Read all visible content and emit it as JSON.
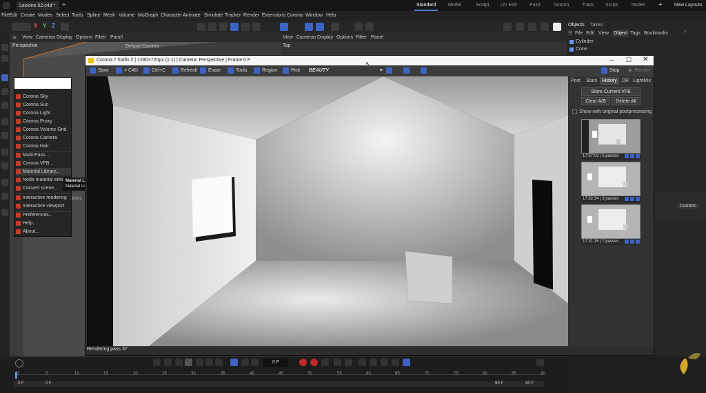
{
  "app": {
    "doc_tab": "Lezione 02.c4d *",
    "layouts": [
      "Standard",
      "Model",
      "Sculpt",
      "UV Edit",
      "Paint",
      "Groom",
      "Track",
      "Script",
      "Nodes"
    ],
    "new_layouts": "New Layouts"
  },
  "menu": [
    "File",
    "Edit",
    "Create",
    "Modes",
    "Select",
    "Tools",
    "Spline",
    "Mesh",
    "Volume",
    "MoGraph",
    "Character",
    "Animate",
    "Simulate",
    "Tracker",
    "Render",
    "Extensions",
    "Corona",
    "Window",
    "Help"
  ],
  "toolbar": {
    "axis_x": "X",
    "axis_y": "Y",
    "axis_z": "Z"
  },
  "viewport_left": {
    "menus": [
      "View",
      "Cameras",
      "Display",
      "Options",
      "Filter",
      "Panel"
    ],
    "name": "Perspective",
    "camera_label": "Default Camera"
  },
  "viewport_right": {
    "menus": [
      "View",
      "Cameras",
      "Display",
      "Options",
      "Filter",
      "Panel"
    ],
    "name": "Top"
  },
  "objects_panel": {
    "tabs": [
      "Objects",
      "Takes"
    ],
    "menus": [
      "File",
      "Edit",
      "View",
      "Object",
      "Tags",
      "Bookmarks"
    ],
    "active_menu": "Object",
    "items": [
      "Cylinder",
      "Cone"
    ],
    "custom_label": "Custom"
  },
  "corona_menu": {
    "items": [
      "Corona Sky",
      "Corona Sun",
      "Corona Light",
      "Corona Proxy",
      "Corona Volume Grid",
      "Corona Camera",
      "Corona Hair",
      "Multi-Pass...",
      "Corona VFB...",
      "Material Library...",
      "Node material editor",
      "Convert scene...",
      "Interactive rendering",
      "Interactive viewport",
      "Preferences...",
      "Help...",
      "About..."
    ],
    "partial_text": "tions"
  },
  "tooltip": {
    "title": "Material Library...",
    "desc": "Material Library..."
  },
  "vfb": {
    "title": "Corona 7 hotfix 2 | 1280×720px (1:1) | Camera: Perspective | Frame 0 F",
    "toolbar": {
      "save": "Save",
      "to_c4d": "> C4D",
      "ctrl_c": "Ctrl+C",
      "refresh": "Refresh",
      "erase": "Erase",
      "tools": "Tools",
      "region": "Region",
      "pick": "Pick",
      "channel": "BEAUTY",
      "stop": "Stop",
      "render": "Render"
    },
    "side_tabs": [
      "Post",
      "Stats",
      "History",
      "DR",
      "LightMix"
    ],
    "active_tab": "History",
    "store_button": "Store Current VFB",
    "clear_ab": "Clear A/B",
    "delete_all": "Delete All",
    "show_original": "Show with original postprocessing",
    "history": [
      {
        "time": "17:37:02",
        "passes": "5 passes"
      },
      {
        "time": "17:32:34",
        "passes": "3 passes"
      },
      {
        "time": "17:31:15",
        "passes": "7 passes"
      }
    ],
    "status": "Rendering pass 37"
  },
  "timeline": {
    "frame_field": "0 F",
    "ticks": [
      "0",
      "5",
      "10",
      "15",
      "20",
      "25",
      "30",
      "35",
      "40",
      "45",
      "50",
      "55",
      "60",
      "65",
      "70",
      "75",
      "80",
      "85",
      "90"
    ],
    "start_a": "0 F",
    "start_b": "0 F",
    "end_a": "90 F",
    "end_b": "90 F"
  },
  "colors": {
    "accent": "#3d63c4",
    "corona_red": "#c63b28",
    "brand_gold": "#d4a72c"
  }
}
